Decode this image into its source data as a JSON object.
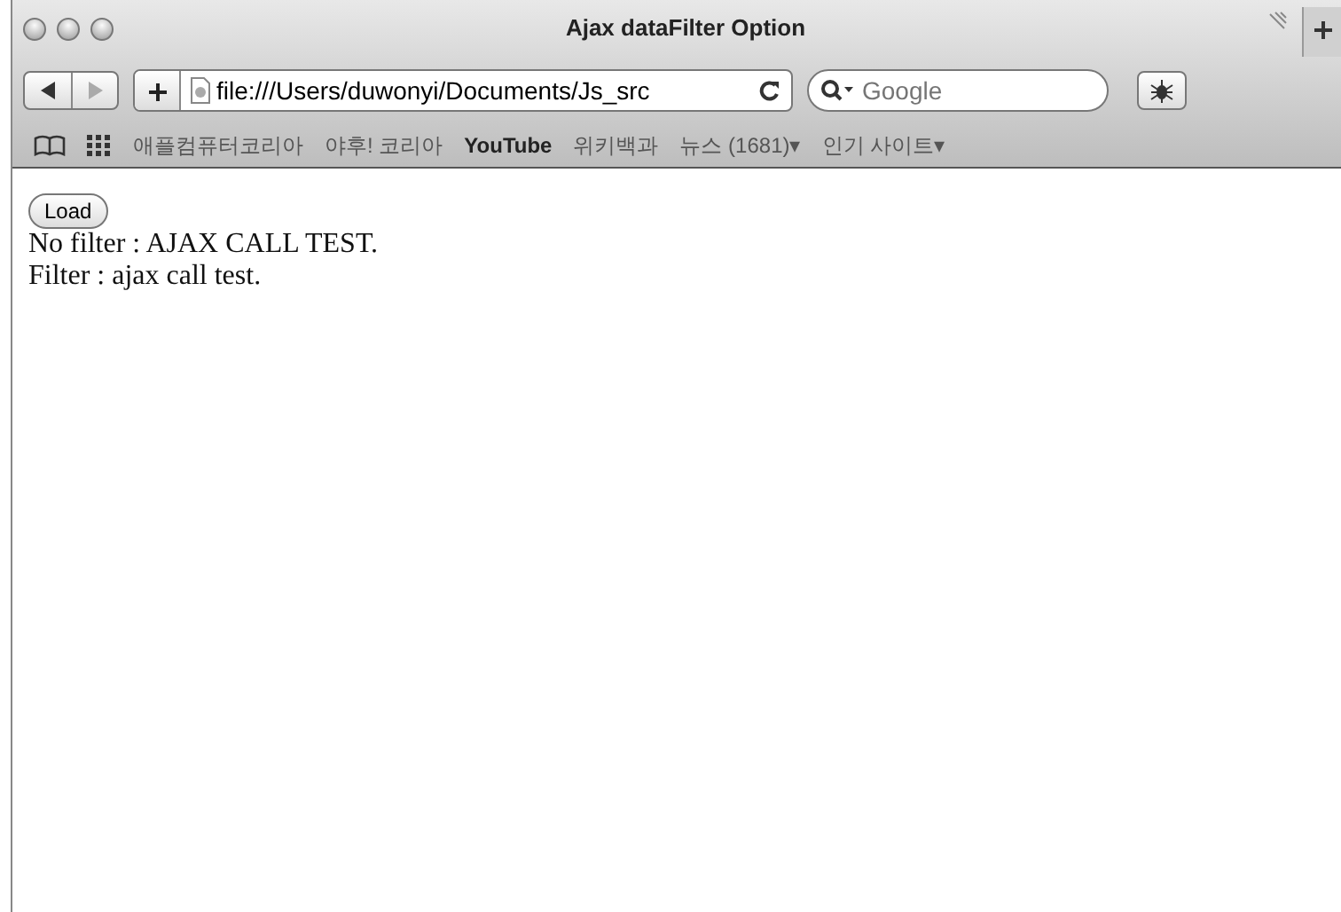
{
  "window": {
    "title": "Ajax dataFilter Option"
  },
  "address_bar": {
    "value": "file:///Users/duwonyi/Documents/Js_src"
  },
  "search": {
    "placeholder": "Google"
  },
  "bookmarks": [
    {
      "label": "애플컴퓨터코리아"
    },
    {
      "label": "야후! 코리아"
    },
    {
      "label": "YouTube"
    },
    {
      "label": "위키백과"
    },
    {
      "label": "뉴스 (1681)▾"
    },
    {
      "label": "인기 사이트▾"
    }
  ],
  "page": {
    "button": "Load",
    "lines": [
      "No filter : AJAX CALL TEST.",
      "Filter : ajax call test."
    ]
  }
}
